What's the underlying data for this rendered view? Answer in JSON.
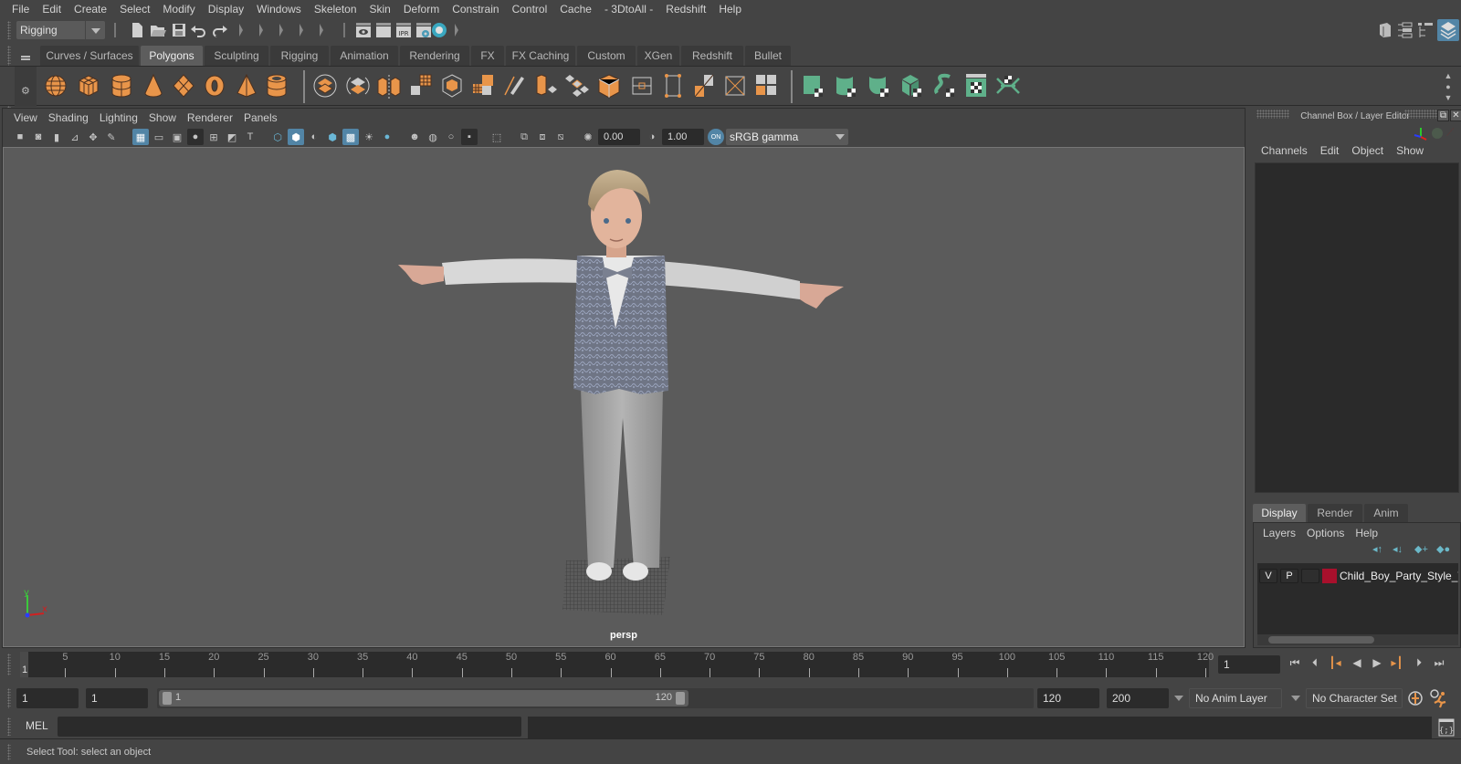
{
  "menubar": [
    "File",
    "Edit",
    "Create",
    "Select",
    "Modify",
    "Display",
    "Windows",
    "Skeleton",
    "Skin",
    "Deform",
    "Constrain",
    "Control",
    "Cache",
    "- 3DtoAll -",
    "Redshift",
    "Help"
  ],
  "statusline": {
    "menu_set": "Rigging",
    "icons": [
      "new-scene-icon",
      "open-scene-icon",
      "save-scene-icon",
      "undo-icon",
      "redo-icon",
      "render-view-icon",
      "render-frame-icon",
      "ipr-render-icon",
      "render-settings-icon",
      "hypershade-icon"
    ],
    "ipr_label": "IPR"
  },
  "shelf": {
    "tabs": [
      "Curves / Surfaces",
      "Polygons",
      "Sculpting",
      "Rigging",
      "Animation",
      "Rendering",
      "FX",
      "FX Caching",
      "Custom",
      "XGen",
      "Redshift",
      "Bullet"
    ],
    "active_tab": "Polygons",
    "colors": {
      "poly_accent": "#e8954a",
      "uv_accent": "#5fb08a"
    }
  },
  "viewport": {
    "menu": [
      "View",
      "Shading",
      "Lighting",
      "Show",
      "Renderer",
      "Panels"
    ],
    "exposure": "0.00",
    "gamma": "1.00",
    "color_space": "sRGB gamma",
    "color_mgmt_label": "ON",
    "camera": "persp",
    "axis": {
      "y": "y",
      "x": "x",
      "z": "z"
    },
    "scene_object": "Child boy in party style outfit, T-pose"
  },
  "channelbox": {
    "title": "Channel Box / Layer Editor",
    "menu": [
      "Channels",
      "Edit",
      "Object",
      "Show"
    ]
  },
  "layereditor": {
    "tabs": [
      "Display",
      "Render",
      "Anim"
    ],
    "active_tab": "Display",
    "menu": [
      "Layers",
      "Options",
      "Help"
    ],
    "layers": [
      {
        "visible": "V",
        "playback": "P",
        "type": "",
        "color": "#a8102c",
        "name": "Child_Boy_Party_Style_TPose"
      }
    ]
  },
  "timeslider": {
    "ticks": [
      5,
      10,
      15,
      20,
      25,
      30,
      35,
      40,
      45,
      50,
      55,
      60,
      65,
      70,
      75,
      80,
      85,
      90,
      95,
      100,
      105,
      110,
      115,
      120
    ],
    "range_min": 1,
    "range_max": 120,
    "current_frame": "1",
    "current_frame_field": "1"
  },
  "rangebar": {
    "start_time": "1",
    "playback_start": "1",
    "range_start_label": "1",
    "range_end_label": "120",
    "playback_end": "120",
    "end_time": "200",
    "anim_layer": "No Anim Layer",
    "character_set": "No Character Set"
  },
  "commandline": {
    "label": "MEL",
    "value": ""
  },
  "helpline": {
    "text": "Select Tool: select an object"
  }
}
